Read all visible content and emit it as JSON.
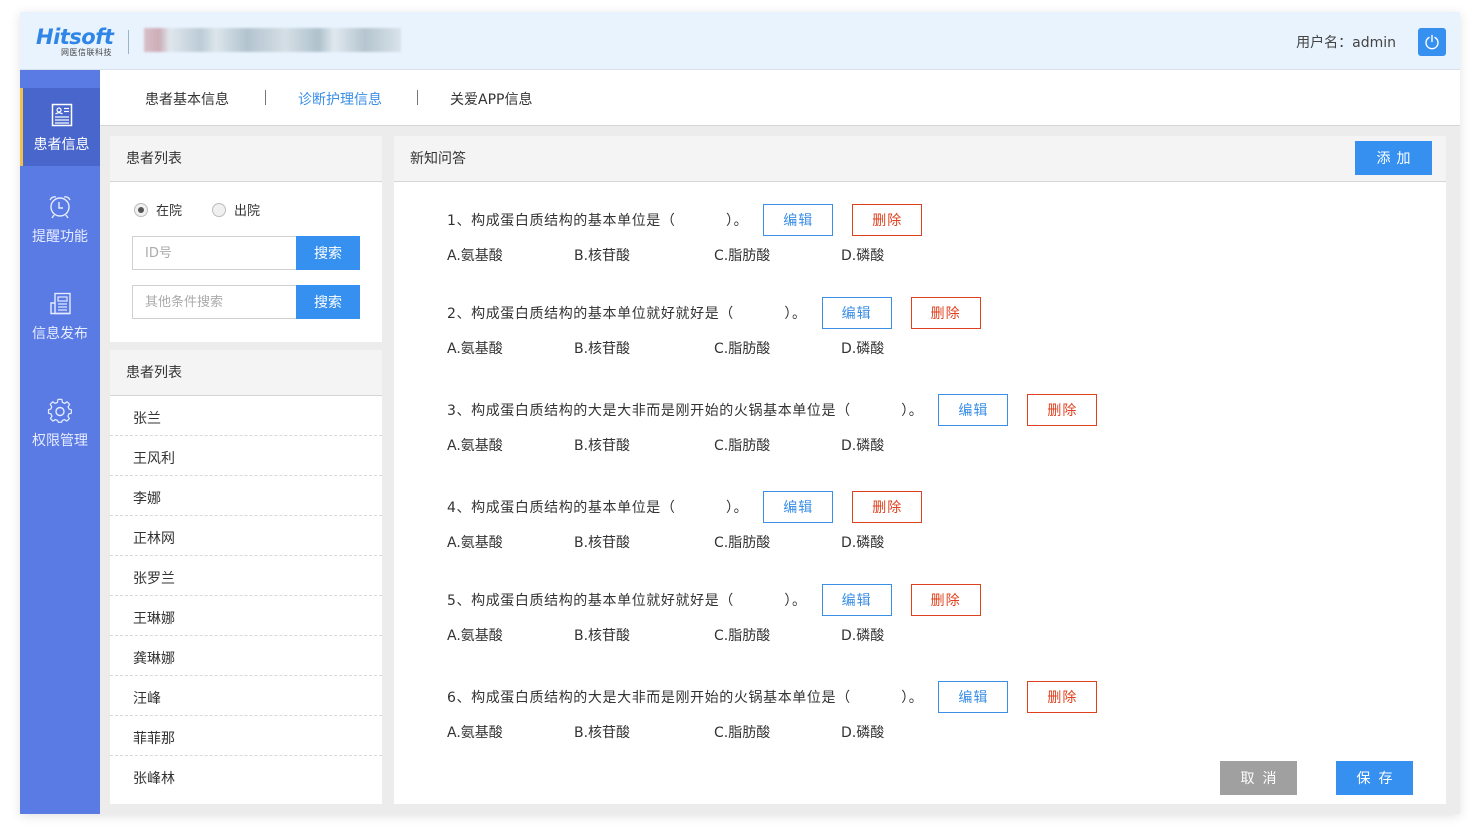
{
  "header": {
    "logo_text": "Hitsoft",
    "logo_subtitle": "网医信联科技",
    "system_title": "(blurred)",
    "username_label": "用户名：admin",
    "power_icon": "power-icon"
  },
  "sidebar": {
    "items": [
      {
        "label": "患者信息",
        "icon": "patient-card-icon",
        "active": true
      },
      {
        "label": "提醒功能",
        "icon": "alarm-clock-icon",
        "active": false
      },
      {
        "label": "信息发布",
        "icon": "newspaper-icon",
        "active": false
      },
      {
        "label": "权限管理",
        "icon": "gear-icon",
        "active": false
      }
    ]
  },
  "tabs": [
    {
      "label": "患者基本信息",
      "active": false
    },
    {
      "label": "诊断护理信息",
      "active": true
    },
    {
      "label": "关爱APP信息",
      "active": false
    }
  ],
  "search_panel": {
    "title": "患者列表",
    "radios": [
      {
        "label": "在院",
        "checked": true
      },
      {
        "label": "出院",
        "checked": false
      }
    ],
    "id_input": {
      "placeholder": "ID号",
      "value": ""
    },
    "other_input": {
      "placeholder": "其他条件搜索",
      "value": ""
    },
    "search_label": "搜索"
  },
  "patient_list": {
    "title": "患者列表",
    "patients": [
      "张兰",
      "王风利",
      "李娜",
      "正林网",
      "张罗兰",
      "王琳娜",
      "龚琳娜",
      "汪峰",
      "菲菲那",
      "张峰林"
    ]
  },
  "qa_panel": {
    "title": "新知问答",
    "add_label": "添加",
    "edit_label": "编辑",
    "delete_label": "删除",
    "cancel_label": "取消",
    "save_label": "保存",
    "questions": [
      {
        "text": "1、构成蛋白质结构的基本单位是（          ）。",
        "options": [
          "A.氨基酸",
          "B.核苷酸",
          "C.脂肪酸",
          "D.磷酸"
        ]
      },
      {
        "text": "2、构成蛋白质结构的基本单位就好就好是（          ）。",
        "options": [
          "A.氨基酸",
          "B.核苷酸",
          "C.脂肪酸",
          "D.磷酸"
        ]
      },
      {
        "text": "3、构成蛋白质结构的大是大非而是刚开始的火锅基本单位是（          ）。",
        "options": [
          "A.氨基酸",
          "B.核苷酸",
          "C.脂肪酸",
          "D.磷酸"
        ]
      },
      {
        "text": "4、构成蛋白质结构的基本单位是（          ）。",
        "options": [
          "A.氨基酸",
          "B.核苷酸",
          "C.脂肪酸",
          "D.磷酸"
        ]
      },
      {
        "text": "5、构成蛋白质结构的基本单位就好就好是（          ）。",
        "options": [
          "A.氨基酸",
          "B.核苷酸",
          "C.脂肪酸",
          "D.磷酸"
        ]
      },
      {
        "text": "6、构成蛋白质结构的大是大非而是刚开始的火锅基本单位是（          ）。",
        "options": [
          "A.氨基酸",
          "B.核苷酸",
          "C.脂肪酸",
          "D.磷酸"
        ]
      }
    ]
  },
  "colors": {
    "primary": "#3690f0",
    "sidebar": "#5a7ae4",
    "sidebar_active": "#4866cc",
    "active_indicator": "#f0c04a",
    "danger": "#e0401e",
    "cancel": "#a0a0a0"
  }
}
